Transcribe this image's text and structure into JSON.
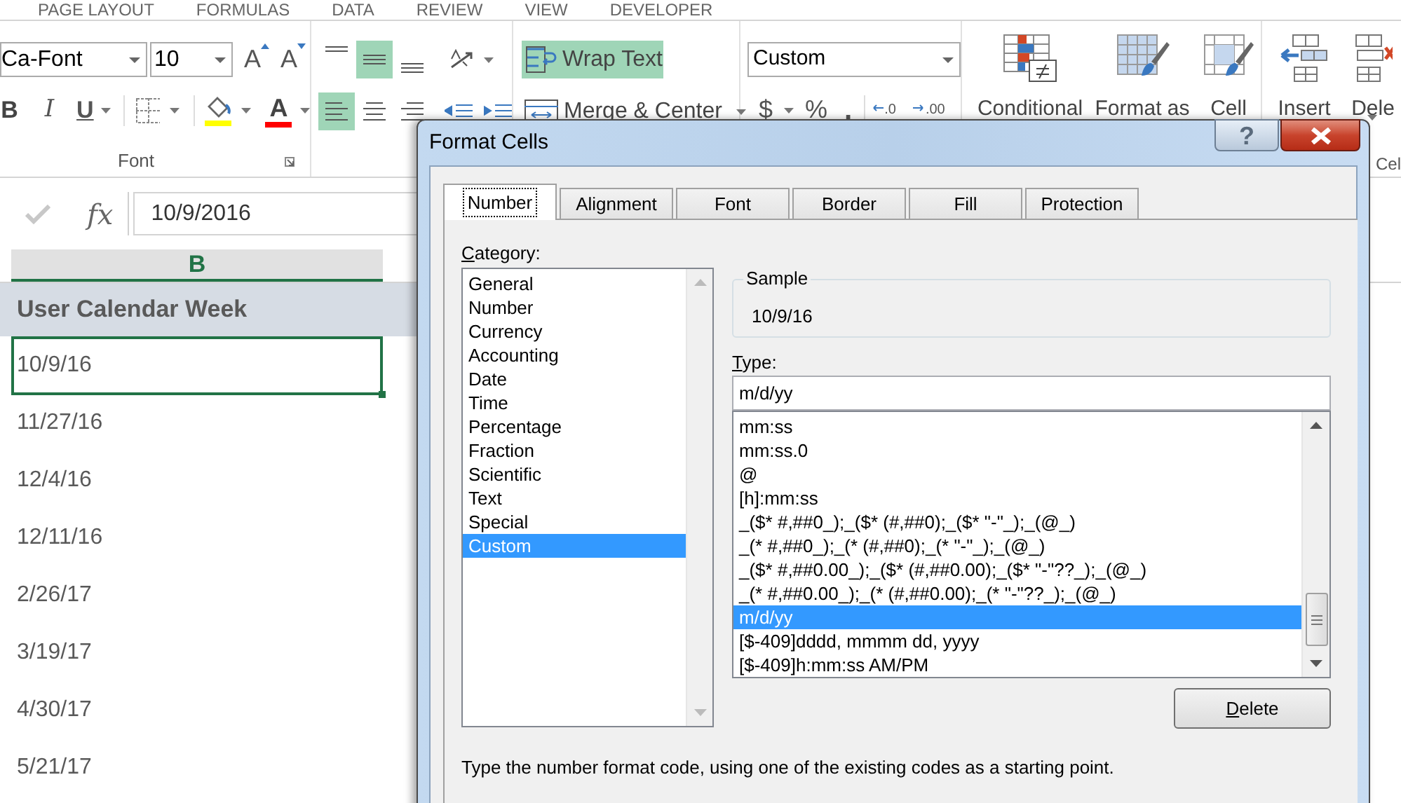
{
  "ribbon_tabs": [
    "PAGE LAYOUT",
    "FORMULAS",
    "DATA",
    "REVIEW",
    "VIEW",
    "DEVELOPER"
  ],
  "font_group": {
    "font_name": "Ca-Font",
    "font_size": "10",
    "grow_font": "A",
    "shrink_font": "A",
    "bold": "B",
    "italic": "I",
    "underline": "U",
    "font_color": "A",
    "label": "Font"
  },
  "alignment_group": {
    "vertical_align": [
      {
        "kind": "top",
        "selected": false
      },
      {
        "kind": "middle",
        "selected": true
      },
      {
        "kind": "bottom",
        "selected": false
      }
    ],
    "horizontal_align": [
      {
        "kind": "left",
        "selected": true
      },
      {
        "kind": "center",
        "selected": false
      },
      {
        "kind": "right",
        "selected": false
      }
    ],
    "wrap_text": {
      "label": "Wrap Text",
      "on": true
    },
    "merge_center": "Merge & Center"
  },
  "number_group": {
    "format": "Custom",
    "currency": "$",
    "percent": "%",
    "comma": ",",
    "increase_decimal": ".0",
    "decrease_decimal": ".00"
  },
  "styles_group": [
    {
      "kind": "conditional",
      "label": "Conditional"
    },
    {
      "kind": "table",
      "label": "Format as"
    },
    {
      "kind": "cell",
      "label": "Cell"
    }
  ],
  "cells_group": {
    "buttons": [
      {
        "kind": "insert",
        "label": "Insert"
      },
      {
        "kind": "delete",
        "label": "Dele"
      }
    ],
    "label": "Cel"
  },
  "formula_bar": {
    "function_label": "fx",
    "value": "10/9/2016"
  },
  "sheet": {
    "column_header": "B",
    "header_cell": "User Calendar Week",
    "cells": [
      {
        "value": "10/9/16",
        "selected": true
      },
      {
        "value": "11/27/16",
        "selected": false
      },
      {
        "value": "12/4/16",
        "selected": false
      },
      {
        "value": "12/11/16",
        "selected": false
      },
      {
        "value": "2/26/17",
        "selected": false
      },
      {
        "value": "3/19/17",
        "selected": false
      },
      {
        "value": "4/30/17",
        "selected": false
      },
      {
        "value": "5/21/17",
        "selected": false
      }
    ]
  },
  "dialog": {
    "title": "Format Cells",
    "help": "?",
    "tabs": [
      {
        "label": "Number",
        "selected": true
      },
      {
        "label": "Alignment",
        "selected": false
      },
      {
        "label": "Font",
        "selected": false
      },
      {
        "label": "Border",
        "selected": false
      },
      {
        "label": "Fill",
        "selected": false
      },
      {
        "label": "Protection",
        "selected": false
      }
    ],
    "category_label": "Category:",
    "categories": [
      {
        "label": "General",
        "selected": false
      },
      {
        "label": "Number",
        "selected": false
      },
      {
        "label": "Currency",
        "selected": false
      },
      {
        "label": "Accounting",
        "selected": false
      },
      {
        "label": "Date",
        "selected": false
      },
      {
        "label": "Time",
        "selected": false
      },
      {
        "label": "Percentage",
        "selected": false
      },
      {
        "label": "Fraction",
        "selected": false
      },
      {
        "label": "Scientific",
        "selected": false
      },
      {
        "label": "Text",
        "selected": false
      },
      {
        "label": "Special",
        "selected": false
      },
      {
        "label": "Custom",
        "selected": true
      }
    ],
    "sample_label": "Sample",
    "sample_value": "10/9/16",
    "type_label": "Type:",
    "type_value": "m/d/yy",
    "types": [
      {
        "label": "mm:ss",
        "selected": false
      },
      {
        "label": "mm:ss.0",
        "selected": false
      },
      {
        "label": "@",
        "selected": false
      },
      {
        "label": "[h]:mm:ss",
        "selected": false
      },
      {
        "label": "_($* #,##0_);_($* (#,##0);_($* \"-\"_);_(@_)",
        "selected": false
      },
      {
        "label": "_(* #,##0_);_(* (#,##0);_(* \"-\"_);_(@_)",
        "selected": false
      },
      {
        "label": "_($* #,##0.00_);_($* (#,##0.00);_($* \"-\"??_);_(@_)",
        "selected": false
      },
      {
        "label": "_(* #,##0.00_);_(* (#,##0.00);_(* \"-\"??_);_(@_)",
        "selected": false
      },
      {
        "label": "m/d/yy",
        "selected": true
      },
      {
        "label": "[$-409]dddd, mmmm dd, yyyy",
        "selected": false
      },
      {
        "label": "[$-409]h:mm:ss AM/PM",
        "selected": false
      }
    ],
    "delete_button": "Delete",
    "description": "Type the number format code, using one of the existing codes as a starting point."
  }
}
